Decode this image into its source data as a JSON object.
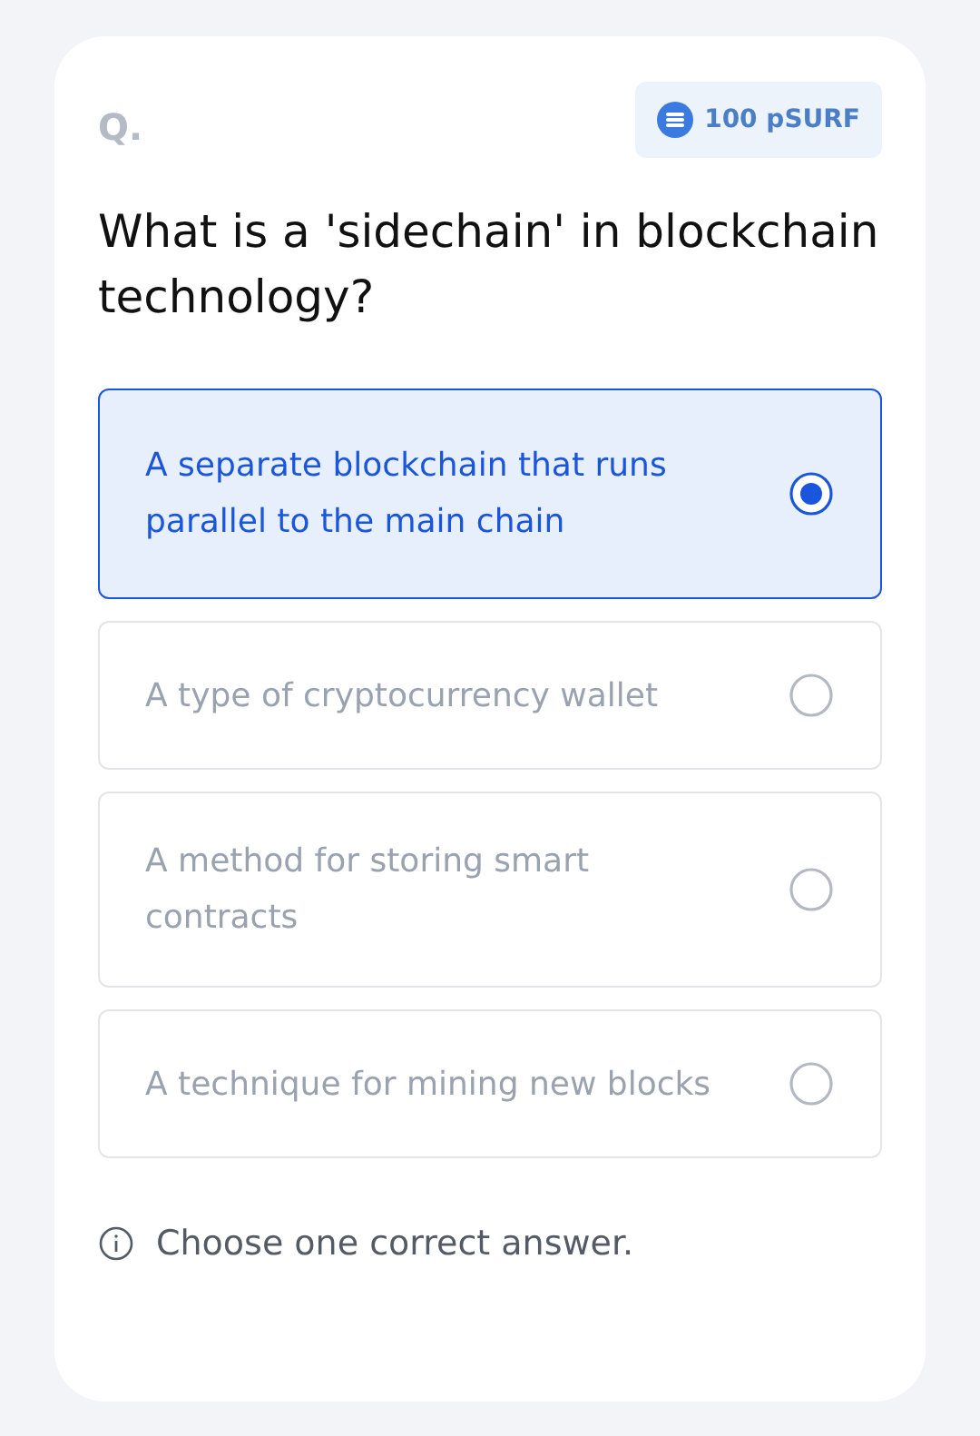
{
  "question_label": "Q.",
  "reward": {
    "amount": "100 pSURF"
  },
  "question": "What is a 'sidechain' in blockchain technology?",
  "options": [
    {
      "text": "A separate blockchain that runs parallel to the main chain",
      "selected": true
    },
    {
      "text": "A type of cryptocurrency wallet",
      "selected": false
    },
    {
      "text": "A method for storing smart contracts",
      "selected": false
    },
    {
      "text": "A technique for mining new blocks",
      "selected": false
    }
  ],
  "hint": "Choose one correct answer."
}
